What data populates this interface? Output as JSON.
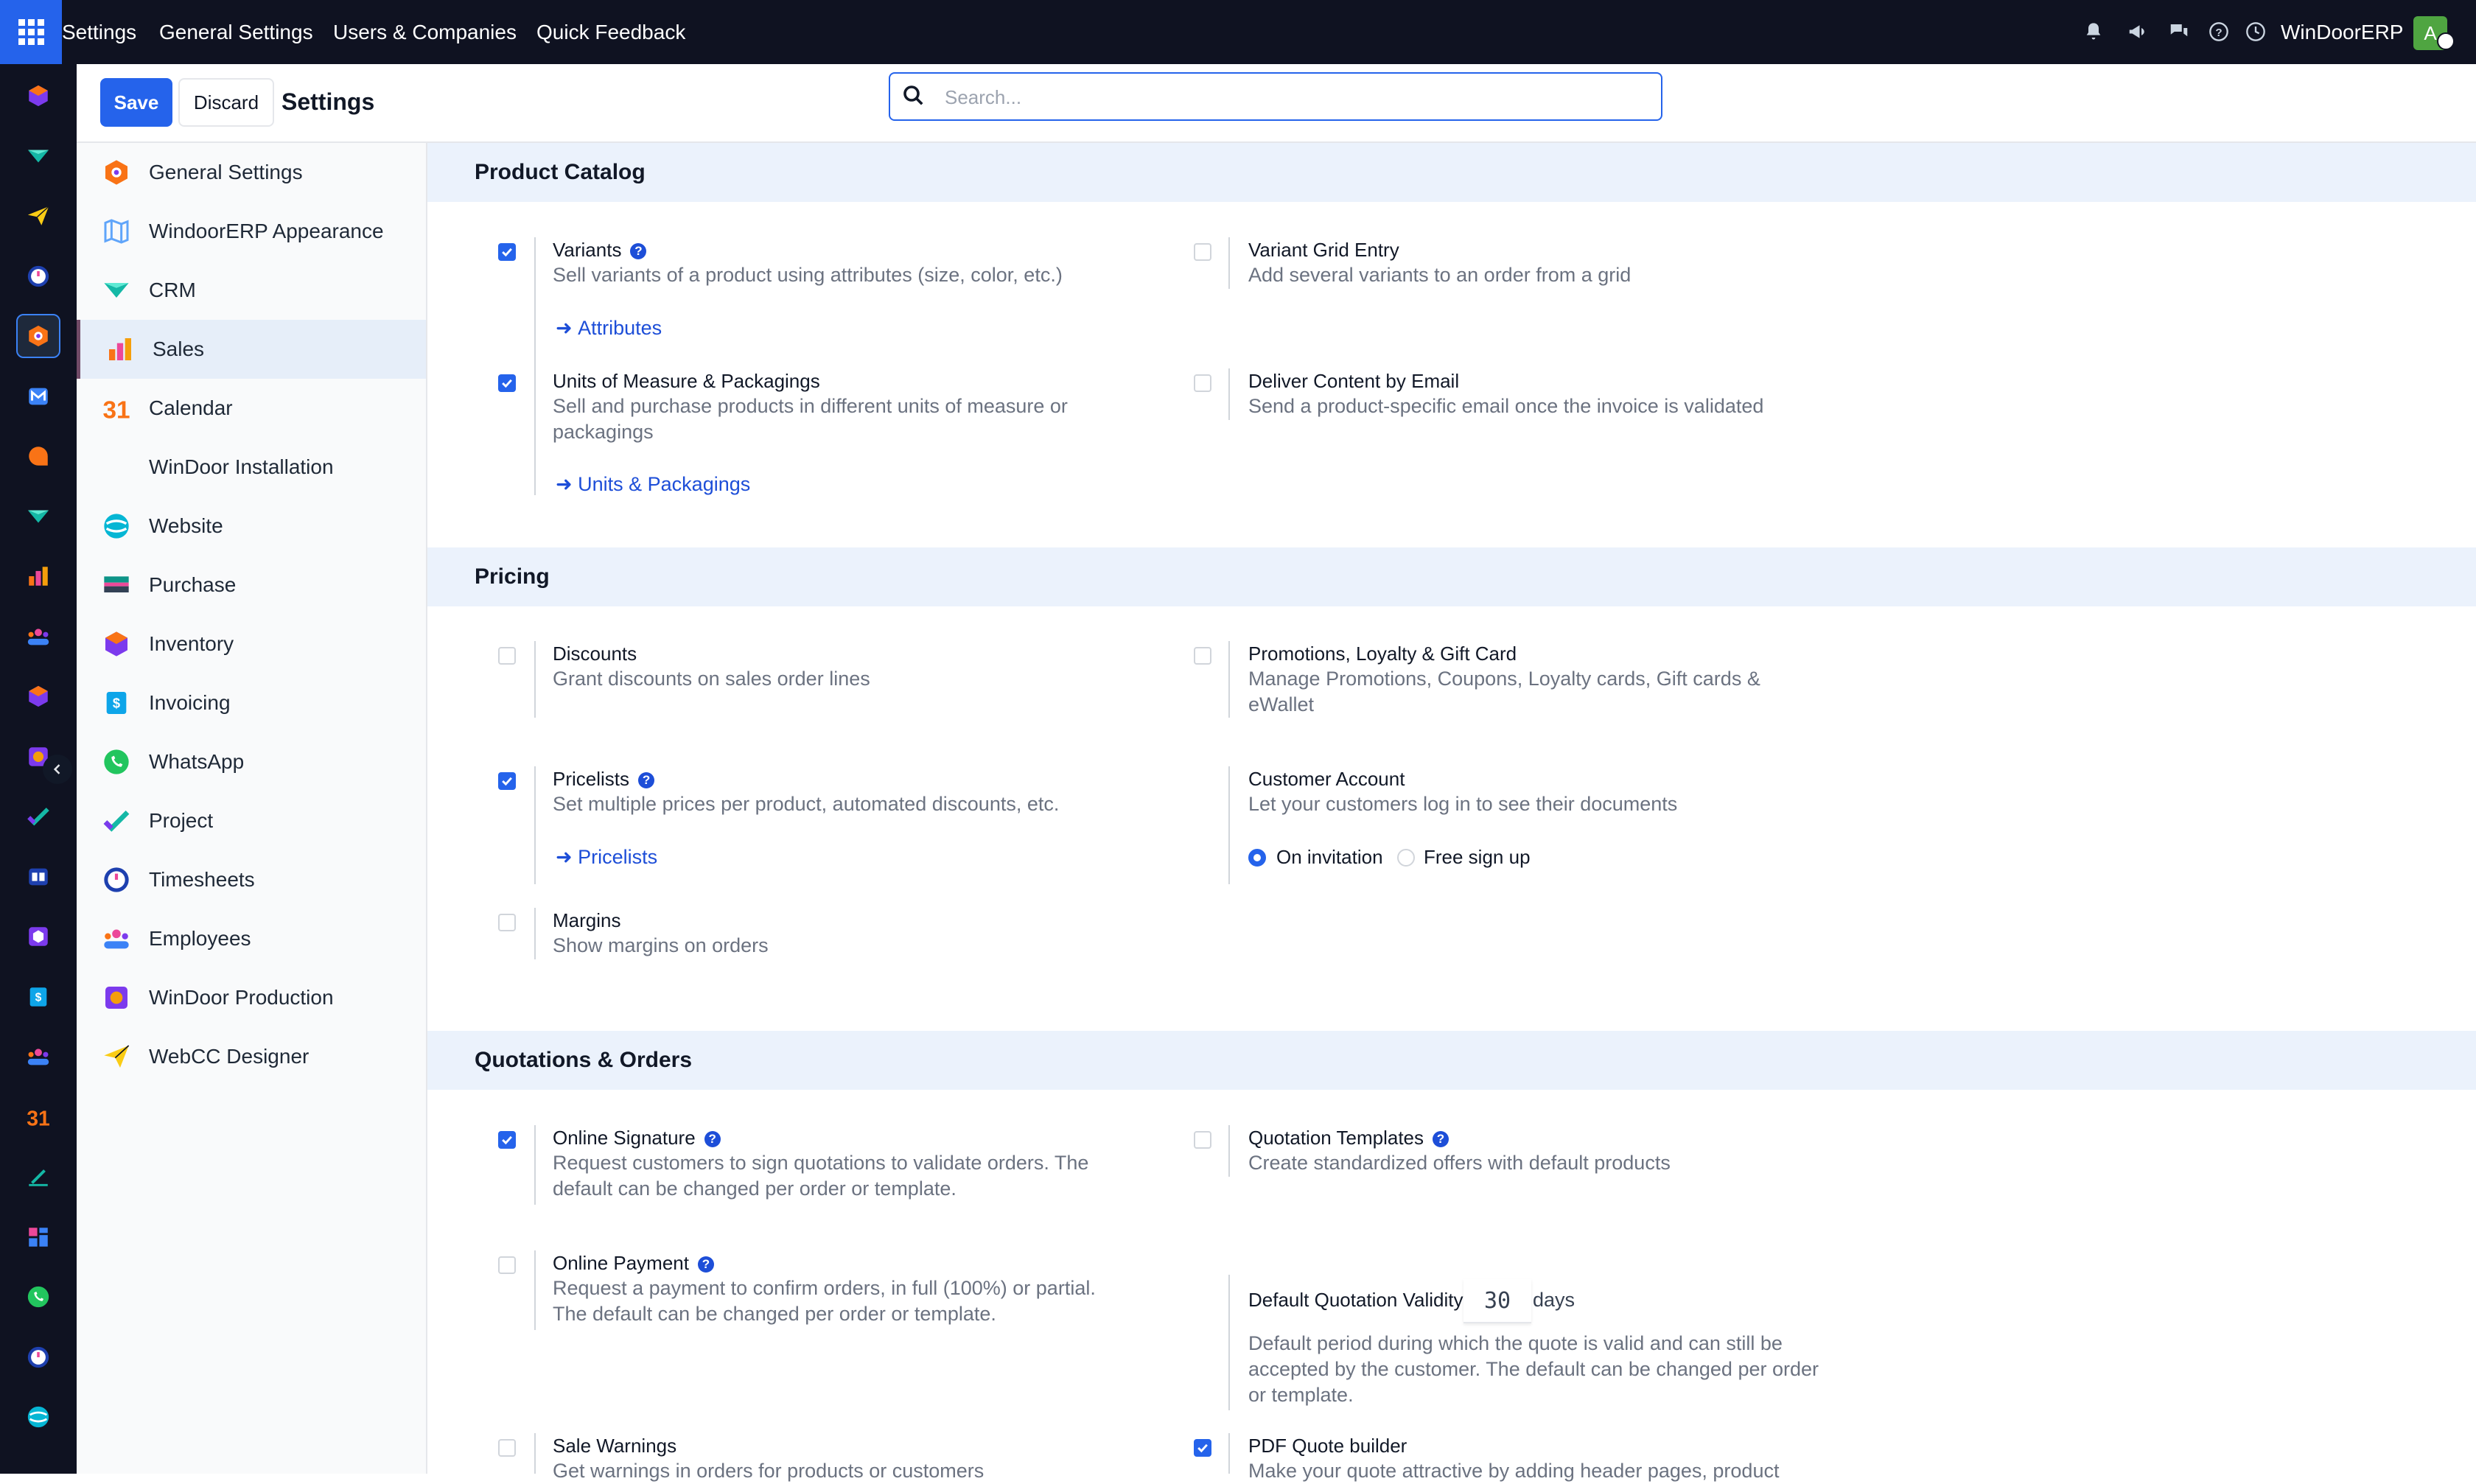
{
  "navbar": {
    "menu": [
      "Settings",
      "General Settings",
      "Users & Companies",
      "Quick Feedback"
    ],
    "company": "WinDoorERP",
    "avatar_letter": "A",
    "systray_icons": [
      "bell-icon",
      "megaphone-icon",
      "chat-icon",
      "help-icon",
      "clock-icon"
    ]
  },
  "app_rail": {
    "icons": [
      "inventory-icon",
      "crm-icon",
      "webcc-designer-icon",
      "timesheets-icon",
      "general-settings-icon",
      "email-marketing-icon",
      "discuss-icon",
      "crm-icon",
      "sales-icon",
      "employees-icon",
      "inventory-icon",
      "production-icon",
      "project-icon",
      "knowledge-icon",
      "inventory-box-icon",
      "invoicing-icon",
      "employees-icon",
      "calendar-icon",
      "sign-icon",
      "dashboard-icon",
      "whatsapp-icon",
      "timesheets-icon",
      "website-icon"
    ],
    "active_index": 4
  },
  "control_panel": {
    "save_label": "Save",
    "discard_label": "Discard",
    "title": "Settings",
    "search_placeholder": "Search..."
  },
  "sidebar": {
    "items": [
      {
        "label": "General Settings",
        "icon": "general-settings-icon"
      },
      {
        "label": "WindoorERP Appearance",
        "icon": "appearance-icon"
      },
      {
        "label": "CRM",
        "icon": "crm-icon"
      },
      {
        "label": "Sales",
        "icon": "sales-icon",
        "active": true
      },
      {
        "label": "Calendar",
        "icon": "calendar-icon"
      },
      {
        "label": "WinDoor Installation",
        "icon": ""
      },
      {
        "label": "Website",
        "icon": "website-icon"
      },
      {
        "label": "Purchase",
        "icon": "purchase-icon"
      },
      {
        "label": "Inventory",
        "icon": "inventory-icon"
      },
      {
        "label": "Invoicing",
        "icon": "invoicing-icon"
      },
      {
        "label": "WhatsApp",
        "icon": "whatsapp-icon"
      },
      {
        "label": "Project",
        "icon": "project-icon"
      },
      {
        "label": "Timesheets",
        "icon": "timesheets-icon"
      },
      {
        "label": "Employees",
        "icon": "employees-icon"
      },
      {
        "label": "WinDoor Production",
        "icon": "production-icon"
      },
      {
        "label": "WebCC Designer",
        "icon": "webcc-designer-icon"
      }
    ],
    "calendar_glyph": "31"
  },
  "sections": {
    "product_catalog": {
      "title": "Product Catalog",
      "variants": {
        "title": "Variants",
        "desc": "Sell variants of a product using attributes (size, color, etc.)",
        "link": "Attributes",
        "checked": true
      },
      "variant_grid": {
        "title": "Variant Grid Entry",
        "desc": "Add several variants to an order from a grid",
        "checked": false
      },
      "uom": {
        "title": "Units of Measure & Packagings",
        "desc": "Sell and purchase products in different units of measure or packagings",
        "link": "Units & Packagings",
        "checked": true
      },
      "deliver_email": {
        "title": "Deliver Content by Email",
        "desc": "Send a product-specific email once the invoice is validated",
        "checked": false
      }
    },
    "pricing": {
      "title": "Pricing",
      "discounts": {
        "title": "Discounts",
        "desc": "Grant discounts on sales order lines",
        "checked": false
      },
      "promotions": {
        "title": "Promotions, Loyalty & Gift Card",
        "desc": "Manage Promotions, Coupons, Loyalty cards, Gift cards & eWallet",
        "checked": false
      },
      "pricelists": {
        "title": "Pricelists",
        "desc": "Set multiple prices per product, automated discounts, etc.",
        "link": "Pricelists",
        "checked": true
      },
      "customer_account": {
        "title": "Customer Account",
        "desc": "Let your customers log in to see their documents",
        "options": [
          "On invitation",
          "Free sign up"
        ],
        "selected": "On invitation"
      },
      "margins": {
        "title": "Margins",
        "desc": "Show margins on orders",
        "checked": false
      }
    },
    "quotations": {
      "title": "Quotations & Orders",
      "online_signature": {
        "title": "Online Signature",
        "desc": "Request customers to sign quotations to validate orders. The default can be changed per order or template.",
        "checked": true
      },
      "quotation_templates": {
        "title": "Quotation Templates",
        "desc": "Create standardized offers with default products",
        "checked": false
      },
      "online_payment": {
        "title": "Online Payment",
        "desc": "Request a payment to confirm orders, in full (100%) or partial. The default can be changed per order or template.",
        "checked": false
      },
      "validity": {
        "label": "Default Quotation Validity",
        "value": "30",
        "unit": "days",
        "desc": "Default period during which the quote is valid and can still be accepted by the customer. The default can be changed per order or template."
      },
      "sale_warnings": {
        "title": "Sale Warnings",
        "desc": "Get warnings in orders for products or customers",
        "checked": false
      },
      "pdf_quote": {
        "title": "PDF Quote builder",
        "desc": "Make your quote attractive by adding header pages, product",
        "checked": true
      }
    }
  },
  "colors": {
    "navbar": "#0f1221",
    "primary": "#2563eb",
    "section_header": "#ebf2fc",
    "sidebar_active": "#e6eef9"
  }
}
